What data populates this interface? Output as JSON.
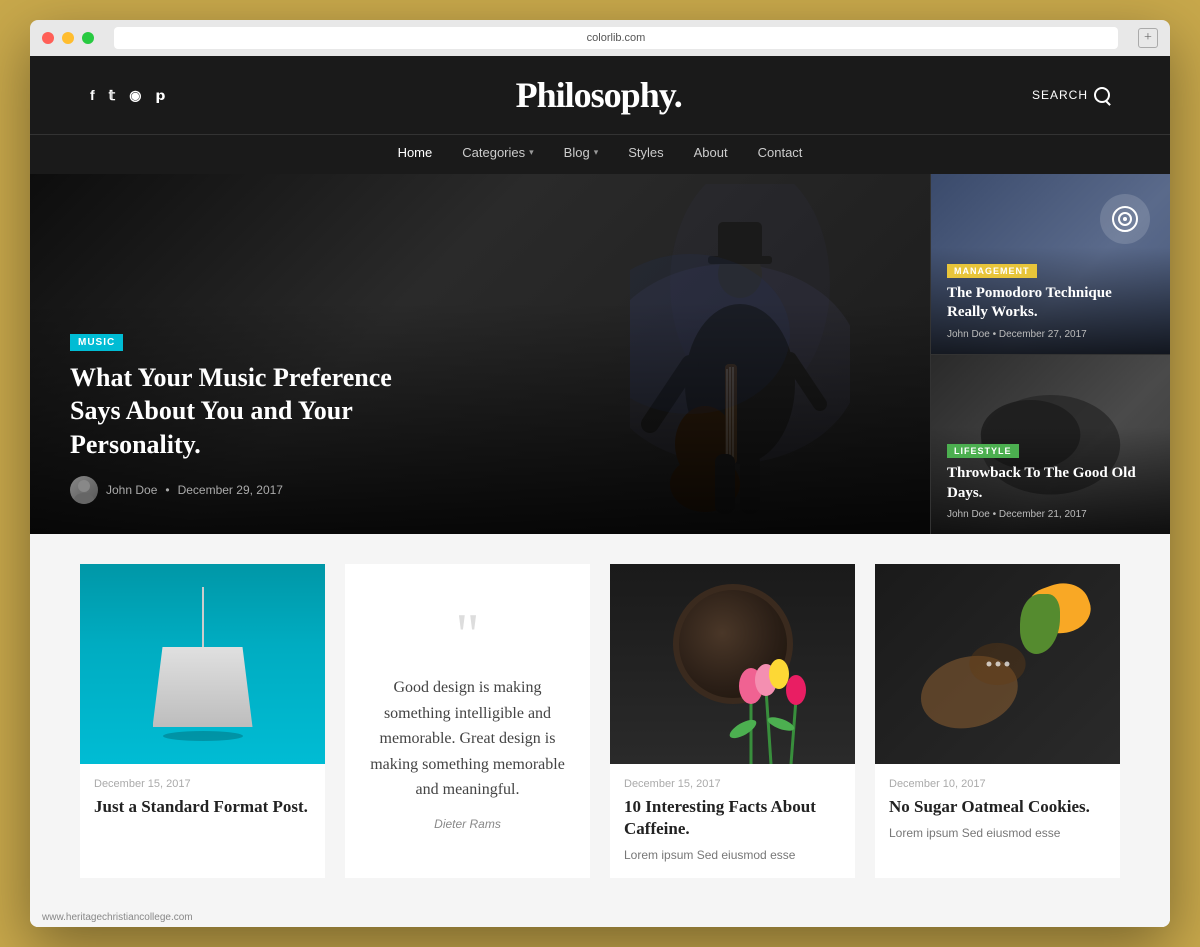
{
  "browser": {
    "url": "colorlib.com",
    "new_tab_label": "+"
  },
  "header": {
    "logo": "Philosophy.",
    "search_label": "SEARCH",
    "social_links": [
      "f",
      "𝕥",
      "⊕",
      "𝐩"
    ]
  },
  "nav": {
    "items": [
      {
        "label": "Home",
        "active": true,
        "has_dropdown": false
      },
      {
        "label": "Categories",
        "active": false,
        "has_dropdown": true
      },
      {
        "label": "Blog",
        "active": false,
        "has_dropdown": true
      },
      {
        "label": "Styles",
        "active": false,
        "has_dropdown": false
      },
      {
        "label": "About",
        "active": false,
        "has_dropdown": false
      },
      {
        "label": "Contact",
        "active": false,
        "has_dropdown": false
      }
    ]
  },
  "hero": {
    "badge": "MUSIC",
    "title": "What Your Music Preference Says About You and Your Personality.",
    "author": "John Doe",
    "date": "December 29, 2017",
    "sidebar_cards": [
      {
        "category": "MANAGEMENT",
        "category_class": "badge-management",
        "title": "The Pomodoro Technique Really Works.",
        "author": "John Doe",
        "date": "December 27, 2017"
      },
      {
        "category": "LIFESTYLE",
        "category_class": "badge-lifestyle",
        "title": "Throwback To The Good Old Days.",
        "author": "John Doe",
        "date": "December 21, 2017"
      }
    ]
  },
  "blog_grid": {
    "cards": [
      {
        "type": "image-lamp",
        "date": "December 15, 2017",
        "title": "Just a Standard Format Post.",
        "excerpt": ""
      },
      {
        "type": "quote",
        "quote_text": "Good design is making something intelligible and memorable. Great design is making something memorable and meaningful.",
        "quote_author": "Dieter Rams"
      },
      {
        "type": "image-coffee",
        "date": "December 15, 2017",
        "title": "10 Interesting Facts About Caffeine.",
        "excerpt": "Lorem ipsum Sed eiusmod esse"
      },
      {
        "type": "image-food",
        "date": "December 10, 2017",
        "title": "No Sugar Oatmeal Cookies.",
        "excerpt": "Lorem ipsum Sed eiusmod esse"
      }
    ]
  },
  "footer": {
    "url": "www.heritagechristiancollege.com"
  }
}
